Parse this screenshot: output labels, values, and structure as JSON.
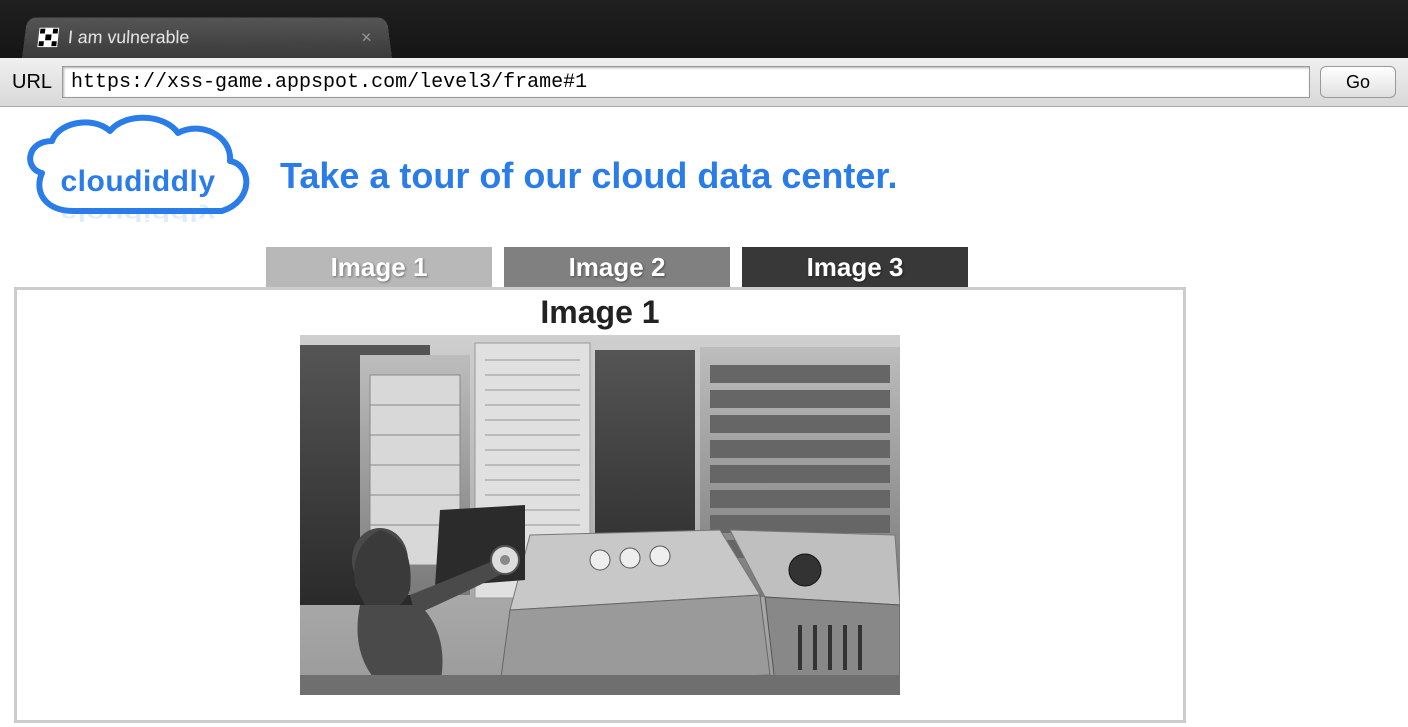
{
  "browser": {
    "tab_title": "I am vulnerable",
    "url_label": "URL",
    "url_value": "https://xss-game.appspot.com/level3/frame#1",
    "go_label": "Go"
  },
  "page": {
    "logo_text": "cloudiddly",
    "headline": "Take a tour of our cloud data center.",
    "tabs": [
      {
        "label": "Image 1"
      },
      {
        "label": "Image 2"
      },
      {
        "label": "Image 3"
      }
    ],
    "content_title": "Image 1"
  }
}
